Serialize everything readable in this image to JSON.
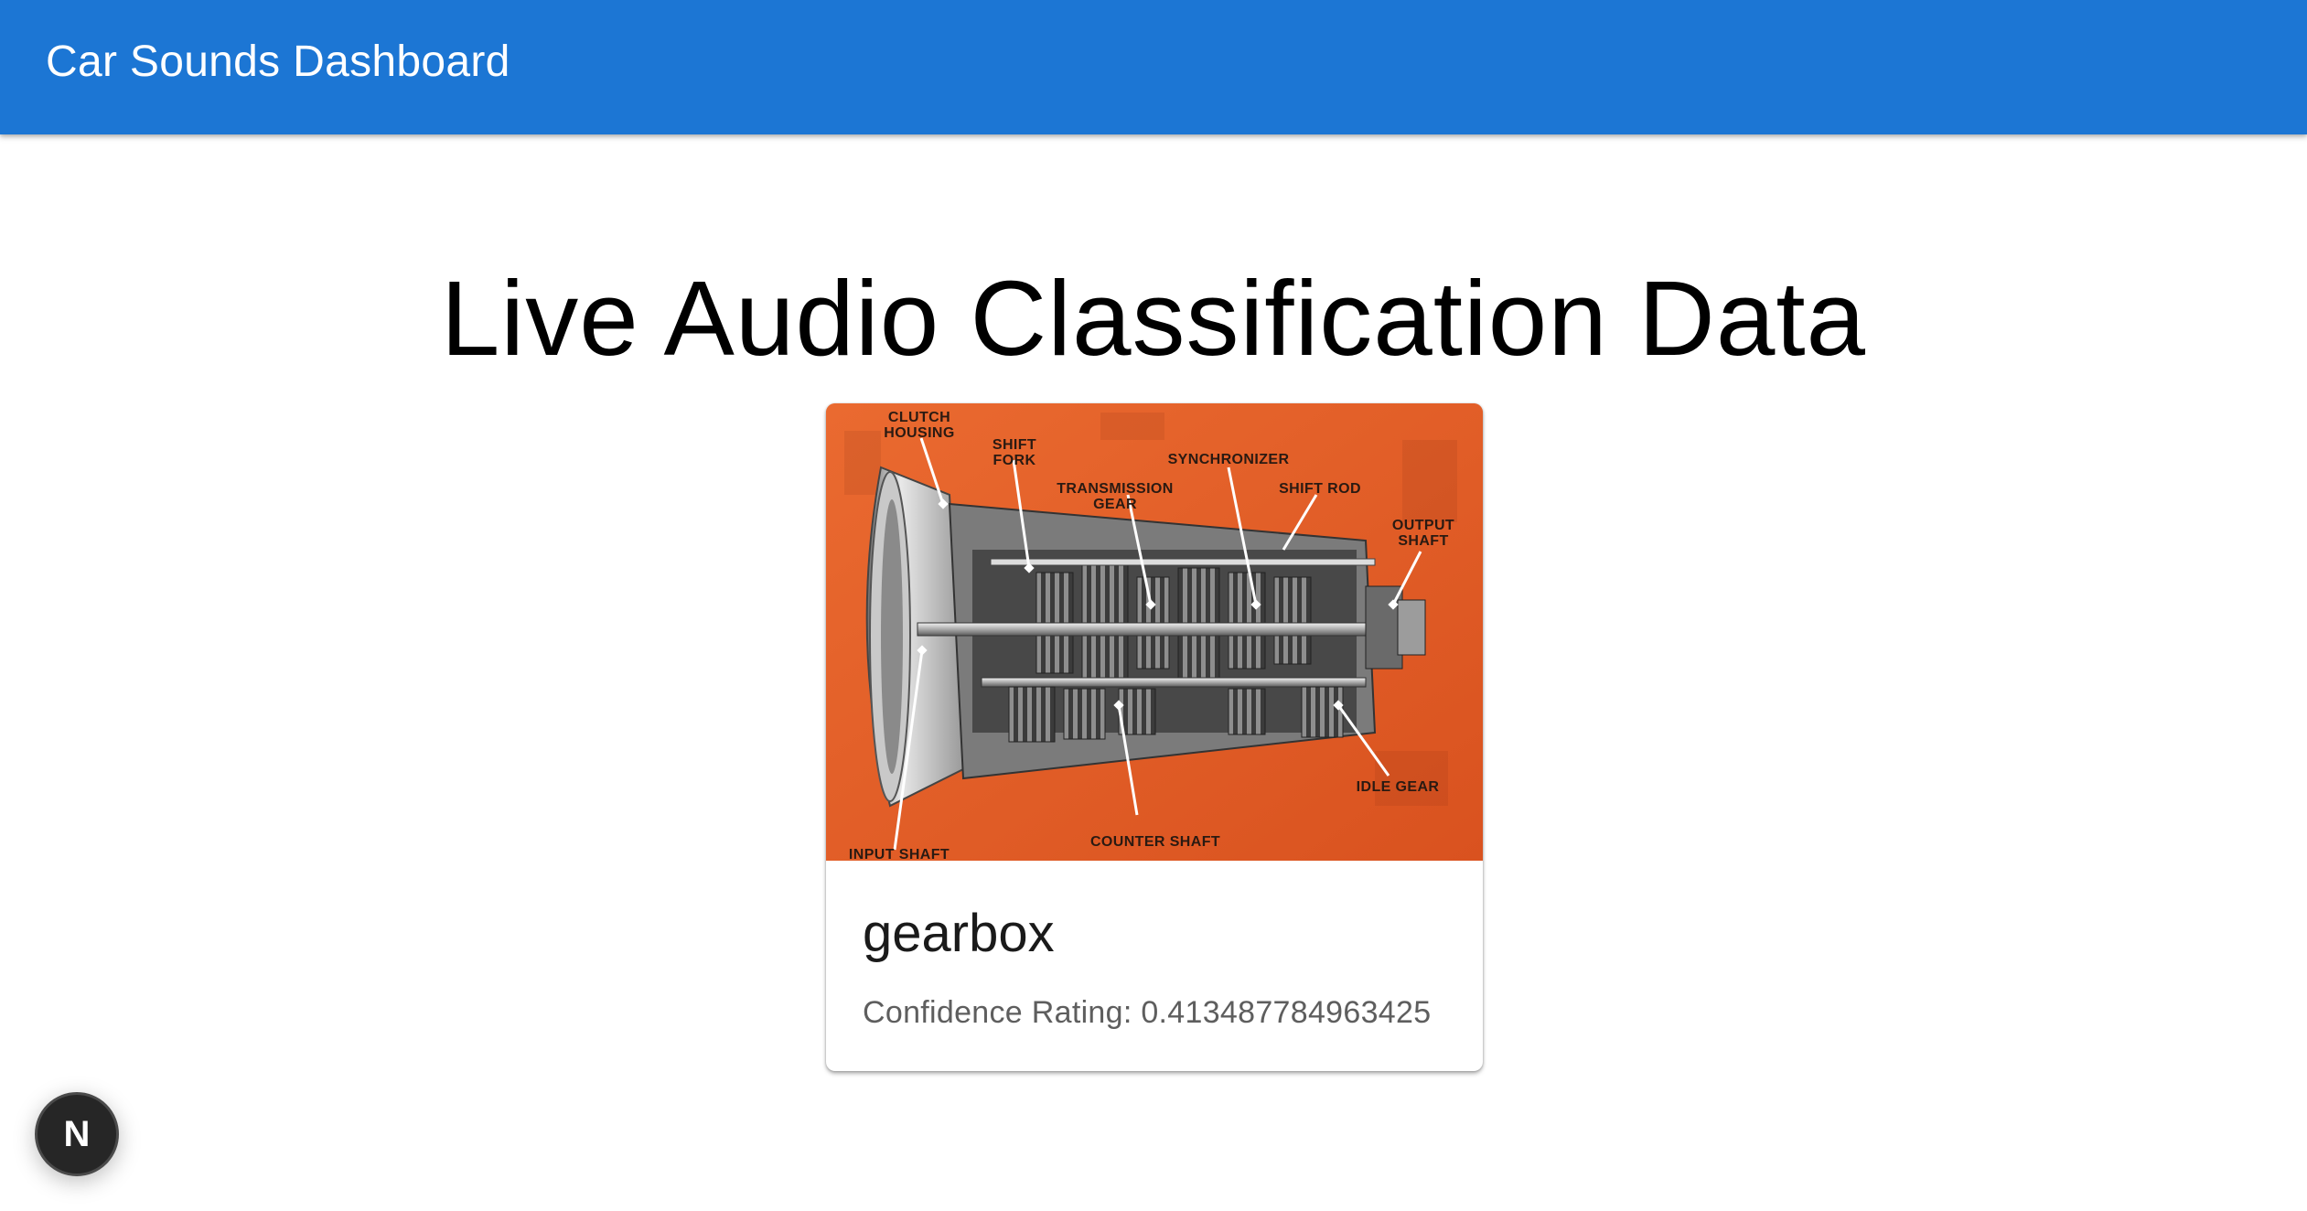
{
  "appbar": {
    "title": "Car Sounds Dashboard",
    "color": "#1c76d4"
  },
  "main": {
    "heading": "Live Audio Classification Data"
  },
  "card": {
    "image_labels": {
      "clutch_housing_1": "CLUTCH",
      "clutch_housing_2": "HOUSING",
      "shift_fork_1": "SHIFT",
      "shift_fork_2": "FORK",
      "transmission_gear_1": "TRANSMISSION",
      "transmission_gear_2": "GEAR",
      "synchronizer": "SYNCHRONIZER",
      "shift_rod": "SHIFT ROD",
      "output_shaft_1": "OUTPUT",
      "output_shaft_2": "SHAFT",
      "idle_gear": "IDLE GEAR",
      "counter_shaft": "COUNTER SHAFT",
      "input_shaft": "INPUT SHAFT"
    },
    "media_color": "#e35f27",
    "title": "gearbox",
    "confidence_text": "Confidence Rating: 0.413487784963425"
  },
  "dev_badge": {
    "letter": "N"
  }
}
